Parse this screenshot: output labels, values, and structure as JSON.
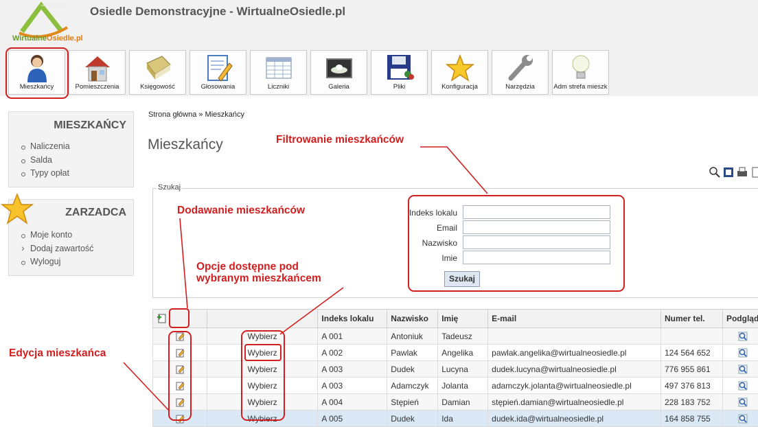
{
  "header": {
    "title": "Osiedle Demonstracyjne - WirtualneOsiedle.pl",
    "logo_text_a": "Wirtualne",
    "logo_text_b": "Osiedle.pl"
  },
  "nav": [
    {
      "label": "Mieszkańcy",
      "icon": "person-icon"
    },
    {
      "label": "Pomieszczenia",
      "icon": "house-icon"
    },
    {
      "label": "Księgowość",
      "icon": "book-icon"
    },
    {
      "label": "Głosowania",
      "icon": "vote-form-icon"
    },
    {
      "label": "Liczniki",
      "icon": "table-icon"
    },
    {
      "label": "Galeria",
      "icon": "gallery-icon"
    },
    {
      "label": "Pliki",
      "icon": "floppy-icon"
    },
    {
      "label": "Konfiguracja",
      "icon": "star-icon"
    },
    {
      "label": "Narzędzia",
      "icon": "wrench-icon"
    },
    {
      "label": "Adm strefa mieszk",
      "icon": "lightbulb-icon"
    }
  ],
  "sidebar": {
    "residents": {
      "title": "MIESZKAŃCY",
      "items": [
        "Naliczenia",
        "Salda",
        "Typy opłat"
      ]
    },
    "manage": {
      "title": "ZARZADCA",
      "items": [
        "Moje konto",
        "Dodaj zawartość",
        "Wyloguj"
      ]
    }
  },
  "breadcrumb": "Strona główna » Mieszkańcy",
  "page_title": "Mieszkańcy",
  "search": {
    "legend": "Szukaj",
    "fields": [
      "Indeks lokalu",
      "Email",
      "Nazwisko",
      "Imie"
    ],
    "button": "Szukaj"
  },
  "table": {
    "headers": [
      "",
      "",
      "Indeks lokalu",
      "Nazwisko",
      "Imię",
      "E-mail",
      "Numer tel.",
      "Podgląd"
    ],
    "select_label": "Wybierz",
    "rows": [
      [
        "A 001",
        "Antoniuk",
        "Tadeusz",
        "",
        ""
      ],
      [
        "A 002",
        "Pawlak",
        "Angelika",
        "pawlak.angelika@wirtualneosiedle.pl",
        "124 564 652"
      ],
      [
        "A 003",
        "Dudek",
        "Lucyna",
        "dudek.lucyna@wirtualneosiedle.pl",
        "776 955 861"
      ],
      [
        "A 003",
        "Adamczyk",
        "Jolanta",
        "adamczyk.jolanta@wirtualneosiedle.pl",
        "497 376 813"
      ],
      [
        "A 004",
        "Stępień",
        "Damian",
        "stępień.damian@wirtualneosiedle.pl",
        "228 183 752"
      ],
      [
        "A 005",
        "Dudek",
        "Ida",
        "dudek.ida@wirtualneosiedle.pl",
        "164 858 755"
      ]
    ]
  },
  "annotations": {
    "filter": "Filtrowanie mieszkańców",
    "add": "Dodawanie mieszkańców",
    "options_1": "Opcje dostępne pod",
    "options_2": "wybranym mieszkańcem",
    "edit": "Edycja mieszkańca"
  },
  "colors": {
    "annotation": "#d21e1e",
    "header_bg": "#f1f1f1",
    "highlight_row": "#dbe9f7"
  }
}
